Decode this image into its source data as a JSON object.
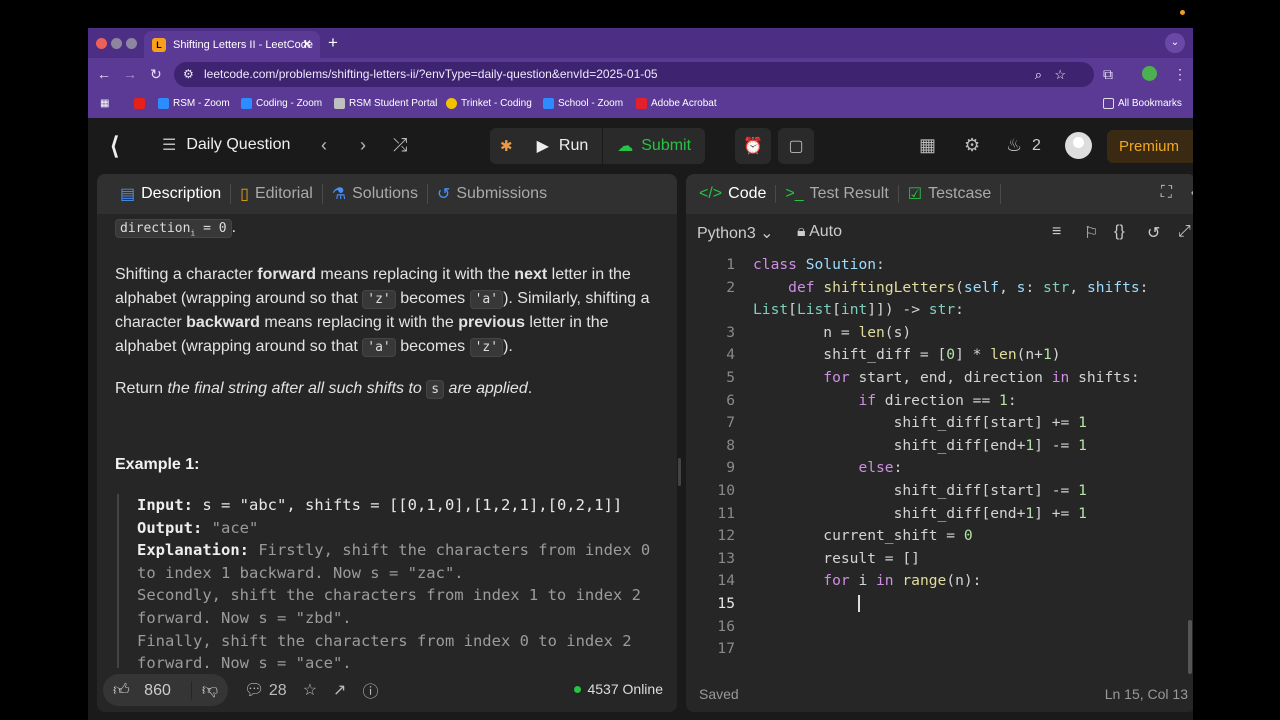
{
  "browser": {
    "tab_title": "Shifting Letters II - LeetCode",
    "tab_close": "✕",
    "new_tab": "+",
    "url": "leetcode.com/problems/shifting-letters-ii/?envType=daily-question&envId=2025-01-05",
    "bookmarks": [
      {
        "label": "RSM - Zoom",
        "color": "#2d8cff"
      },
      {
        "label": "Coding - Zoom",
        "color": "#2d8cff"
      },
      {
        "label": "RSM Student Portal",
        "color": "#c0c0c0"
      },
      {
        "label": "Trinket - Coding",
        "color": "#f3c200"
      },
      {
        "label": "School - Zoom",
        "color": "#2d8cff"
      },
      {
        "label": "Adobe Acrobat",
        "color": "#e3202c"
      }
    ],
    "all_bookmarks": "All Bookmarks"
  },
  "lc": {
    "daily_question": "Daily Question",
    "run": "Run",
    "submit": "Submit",
    "streak": "2",
    "premium": "Premium"
  },
  "left_tabs": [
    "Description",
    "Editorial",
    "Solutions",
    "Submissions"
  ],
  "description": {
    "top_code": "direction",
    "top_sub": "i",
    "top_rest": " = 0",
    "p1_a": "Shifting a character ",
    "p1_b": "forward",
    "p1_c": " means replacing it with the ",
    "p1_d": "next",
    "p1_e": " letter in the alphabet (wrapping around so that ",
    "p1_z": "'z'",
    "p1_f": " becomes ",
    "p1_a2": "'a'",
    "p1_g": "). Similarly, shifting a character ",
    "p1_h": "backward",
    "p1_i": " means replacing it with the ",
    "p1_j": "previous",
    "p1_k": " letter in the alphabet (wrapping around so that ",
    "p1_l": "'a'",
    "p1_m": " becomes ",
    "p1_n": "'z'",
    "p1_o": ").",
    "p2_a": "Return ",
    "p2_b": "the final string after all such shifts to ",
    "p2_s": "s",
    "p2_c": " are applied",
    "p2_d": ".",
    "example_title": "Example 1:",
    "input_label": "Input:",
    "input_value": " s = \"abc\", shifts = [[0,1,0],[1,2,1],[0,2,1]]",
    "output_label": "Output:",
    "output_value": " \"ace\"",
    "explanation_label": "Explanation:",
    "explanation_value": " Firstly, shift the characters from index 0 to index 1 backward. Now s = \"zac\".",
    "expl_2": "Secondly, shift the characters from index 1 to index 2 forward. Now s = \"zbd\".",
    "expl_3": "Finally, shift the characters from index 0 to index 2 forward. Now s = \"ace\"."
  },
  "footer_left": {
    "likes": "860",
    "comments": "28",
    "online": "4537 Online"
  },
  "right_tabs": [
    "Code",
    "Test Result",
    "Testcase"
  ],
  "editor": {
    "language": "Python3",
    "auto": "Auto",
    "line_numbers": [
      "1",
      "2",
      "",
      "3",
      "4",
      "5",
      "6",
      "7",
      "8",
      "9",
      "10",
      "11",
      "12",
      "13",
      "14",
      "15",
      "16",
      "17"
    ],
    "status_left": "Saved",
    "status_right": "Ln 15, Col 13"
  }
}
